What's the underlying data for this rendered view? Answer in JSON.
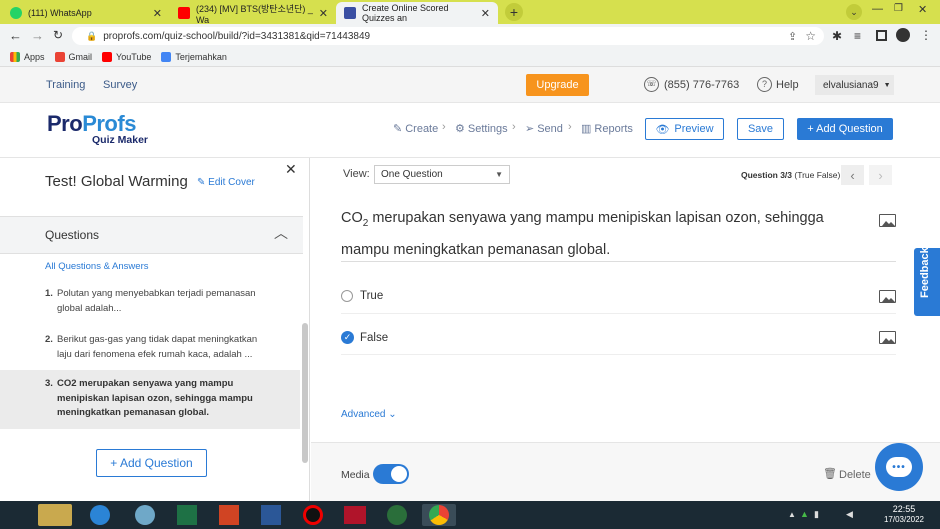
{
  "browser": {
    "tabs": [
      {
        "title": "(111) WhatsApp",
        "color": "#25d366"
      },
      {
        "title": "(234) [MV] BTS(방탄소년단) _ Wa",
        "color": "#ff0000"
      },
      {
        "title": "Create Online Scored Quizzes an",
        "color": "#3a4fa3"
      }
    ],
    "url": "proprofs.com/quiz-school/build/?id=3431381&qid=71443849",
    "bookmarks": [
      "Apps",
      "Gmail",
      "YouTube",
      "Terjemahkan"
    ]
  },
  "topbar": {
    "links": [
      "Training",
      "Survey"
    ],
    "upgrade": "Upgrade",
    "phone": "(855) 776-7763",
    "help": "Help",
    "user": "elvalusiana9"
  },
  "header": {
    "logo_pro": "Pro",
    "logo_profs": "Profs",
    "logo_sub": "Quiz Maker",
    "nav": [
      "Create",
      "Settings",
      "Send",
      "Reports"
    ],
    "preview": "Preview",
    "save": "Save",
    "add_question": "+ Add Question"
  },
  "sidebar": {
    "title": "Test! Global Warming",
    "edit_cover": "Edit Cover",
    "section": "Questions",
    "all_link": "All Questions & Answers",
    "questions": [
      {
        "num": "1.",
        "text": "Polutan yang menyebabkan terjadi pemanasan global adalah..."
      },
      {
        "num": "2.",
        "text": "Berikut gas-gas yang tidak dapat meningkatkan laju dari fenomena efek rumah kaca, adalah ..."
      },
      {
        "num": "3.",
        "text": "CO2 merupakan senyawa yang mampu menipiskan lapisan ozon, sehingga mampu meningkatkan pemanasan global."
      }
    ],
    "add_question": "+ Add Question"
  },
  "main": {
    "view_label": "View:",
    "view_value": "One Question",
    "question_counter": "Question 3/3",
    "question_type": "(True False)",
    "question_co": "CO",
    "question_sub": "2",
    "question_rest": " merupakan senyawa yang mampu menipiskan lapisan ozon, sehingga mampu meningkatkan pemanasan global.",
    "answers": [
      {
        "label": "True",
        "selected": false
      },
      {
        "label": "False",
        "selected": true
      }
    ],
    "advanced": "Advanced",
    "media": "Media",
    "media_on": true,
    "delete": "Delete",
    "feedback": "Feedback"
  },
  "taskbar": {
    "time": "22:55",
    "date": "17/03/2022"
  },
  "colors": {
    "accent": "#2a7ad5",
    "upgrade": "#f7941d",
    "tabbar": "#d6e04e"
  }
}
